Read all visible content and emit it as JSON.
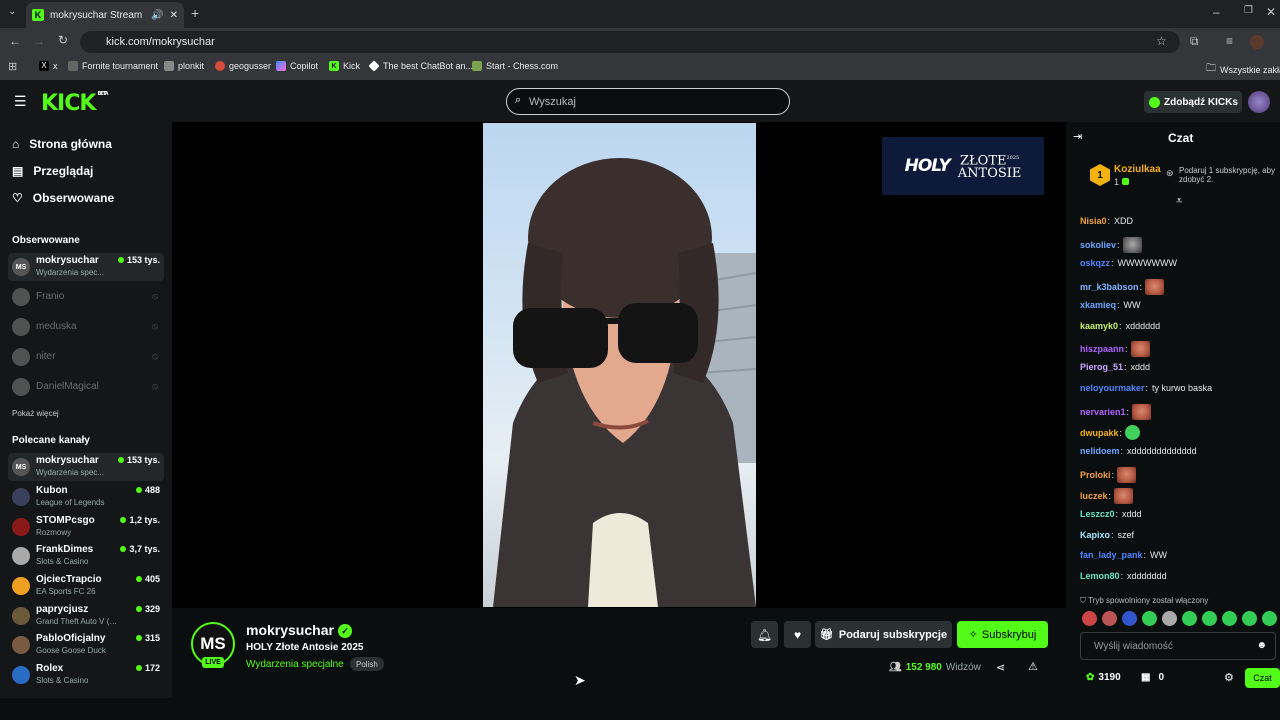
{
  "browser": {
    "tab_title": "mokrysuchar Stream - Watc",
    "url": "kick.com/mokrysuchar",
    "bookmarks": [
      "x",
      "Fornite tournament",
      "plonkit",
      "geogusser",
      "Copilot",
      "Kick",
      "The best ChatBot an...",
      "Start - Chess.com"
    ],
    "bookmarks_folder": "Wszystkie zakład"
  },
  "header": {
    "logo": "KICK",
    "logo_tag": "BETA",
    "search_placeholder": "Wyszukaj",
    "kicks_button": "Zdobądź KICKs"
  },
  "sidebar": {
    "nav": [
      {
        "label": "Strona główna",
        "icon": "home-icon"
      },
      {
        "label": "Przeglądaj",
        "icon": "browse-icon"
      },
      {
        "label": "Obserwowane",
        "icon": "heart-icon"
      }
    ],
    "followed_title": "Obserwowane",
    "followed": [
      {
        "name": "mokrysuchar",
        "category": "Wydarzenia spec...",
        "viewers": "153 tys.",
        "live": true
      },
      {
        "name": "Franio",
        "live": false
      },
      {
        "name": "meduska",
        "live": false
      },
      {
        "name": "niter",
        "live": false
      },
      {
        "name": "DanielMagical",
        "live": false
      }
    ],
    "show_more": "Pokaż więcej",
    "recommended_title": "Polecane kanały",
    "recommended": [
      {
        "name": "mokrysuchar",
        "category": "Wydarzenia spec...",
        "viewers": "153 tys."
      },
      {
        "name": "Kubon",
        "category": "League of Legends",
        "viewers": "488"
      },
      {
        "name": "STOMPcsgo",
        "category": "Rozmowy",
        "viewers": "1,2 tys."
      },
      {
        "name": "FrankDimes",
        "category": "Slots & Casino",
        "viewers": "3,7 tys."
      },
      {
        "name": "OjciecTrapcio",
        "category": "EA Sports FC 26",
        "viewers": "405"
      },
      {
        "name": "paprycjusz",
        "category": "Grand Theft Auto V (G...",
        "viewers": "329"
      },
      {
        "name": "PabloOficjalny",
        "category": "Goose Goose Duck",
        "viewers": "315"
      },
      {
        "name": "Rolex",
        "category": "Slots & Casino",
        "viewers": "172"
      }
    ]
  },
  "video": {
    "ad_brand": "HOLY",
    "ad_line1": "ZŁOTE",
    "ad_line2": "ANTOSIE",
    "ad_year": "2025"
  },
  "stream": {
    "avatar_initials": "MS",
    "live_badge": "LIVE",
    "streamer": "mokrysuchar",
    "title": "HOLY Złote Antosie 2025",
    "category": "Wydarzenia specjalne",
    "language": "Polish",
    "gift_button": "Podaruj subskrypcje",
    "subscribe_button": "Subskrybuj",
    "viewers": "152 980",
    "viewers_label": "Widzów"
  },
  "chat": {
    "title": "Czat",
    "pinned_badge": "1",
    "pinned_user": "Koziulkaa",
    "pinned_count": "1",
    "pinned_info": "Podaruj 1 subskrypcję, aby zdobyć 2.",
    "messages": [
      {
        "user": "Nisia0",
        "color": "#f4a13a",
        "text": "XDD",
        "emote": ""
      },
      {
        "user": "sokoliev",
        "color": "#6aa6ff",
        "text": "",
        "emote": "gray"
      },
      {
        "user": "oskqzz",
        "color": "#4b86ff",
        "text": "WWWWWWW",
        "emote": ""
      },
      {
        "user": "mr_k3babson",
        "color": "#7db0ff",
        "text": "",
        "emote": "face"
      },
      {
        "user": "xkamieq",
        "color": "#6aa6ff",
        "text": "WW",
        "emote": ""
      },
      {
        "user": "kaamyk0",
        "color": "#c7f06b",
        "text": "xdddddd",
        "emote": ""
      },
      {
        "user": "hiszpaann",
        "color": "#b060ff",
        "text": "",
        "emote": "face"
      },
      {
        "user": "Pierog_51",
        "color": "#c9a4ff",
        "text": "xddd",
        "emote": ""
      },
      {
        "user": "neloyourmaker",
        "color": "#4b86ff",
        "text": "ty kurwo baska",
        "emote": ""
      },
      {
        "user": "nervarien1",
        "color": "#b060ff",
        "text": "",
        "emote": "face"
      },
      {
        "user": "dwupakk",
        "color": "#f4b20b",
        "text": "",
        "emote": "green"
      },
      {
        "user": "nelidoem",
        "color": "#6aa6ff",
        "text": "xddddddddddddd",
        "emote": ""
      },
      {
        "user": "Proloki",
        "color": "#f4a13a",
        "text": "",
        "emote": "face"
      },
      {
        "user": "luczek",
        "color": "#f4a13a",
        "text": "",
        "emote": "face"
      },
      {
        "user": "Leszcz0",
        "color": "#6be3c2",
        "text": "xddd",
        "emote": ""
      },
      {
        "user": "Kapixo",
        "color": "#a6e6ff",
        "text": "szef",
        "emote": ""
      },
      {
        "user": "fan_lady_pank",
        "color": "#4b86ff",
        "text": "WW",
        "emote": ""
      },
      {
        "user": "Lemon80",
        "color": "#6be3c2",
        "text": "xddddddd",
        "emote": ""
      }
    ],
    "slow_mode_note": "Tryb spowolniony został włączony",
    "input_placeholder": "Wyślij wiadomość",
    "points": "3190",
    "gifts": "0",
    "send_button": "Czat"
  }
}
